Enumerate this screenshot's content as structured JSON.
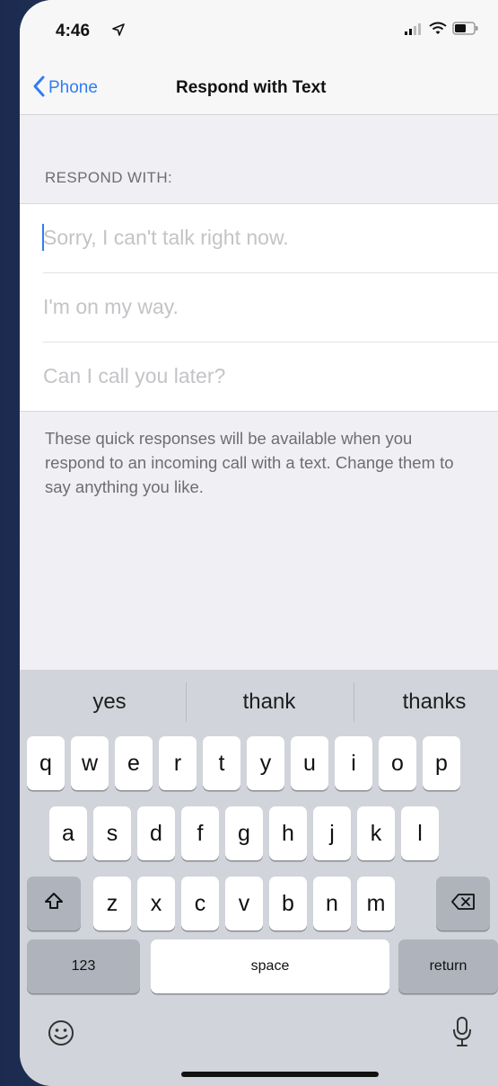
{
  "status_bar": {
    "time": "4:46"
  },
  "nav": {
    "back_label": "Phone",
    "title": "Respond with Text"
  },
  "section": {
    "header": "RESPOND WITH:"
  },
  "responses": [
    {
      "placeholder": "Sorry, I can't talk right now."
    },
    {
      "placeholder": "I'm on my way."
    },
    {
      "placeholder": "Can I call you later?"
    }
  ],
  "footer": {
    "text": "These quick responses will be available when you respond to an incoming call with a text. Change them to say anything you like."
  },
  "keyboard": {
    "suggestions": [
      "yes",
      "thank",
      "thanks"
    ],
    "row1": [
      "q",
      "w",
      "e",
      "r",
      "t",
      "y",
      "u",
      "i",
      "o",
      "p"
    ],
    "row2": [
      "a",
      "s",
      "d",
      "f",
      "g",
      "h",
      "j",
      "k",
      "l"
    ],
    "row3": [
      "z",
      "x",
      "c",
      "v",
      "b",
      "n",
      "m"
    ],
    "numbers_label": "123",
    "space_label": "space",
    "return_label": "return"
  },
  "colors": {
    "accent": "#2f7df6",
    "background": "#efeff4",
    "keyboard": "#d1d4da"
  },
  "icons": [
    "location-arrow-icon",
    "signal-icon",
    "wifi-icon",
    "battery-icon",
    "back-chevron-icon",
    "shift-icon",
    "delete-icon",
    "emoji-icon",
    "microphone-icon"
  ]
}
